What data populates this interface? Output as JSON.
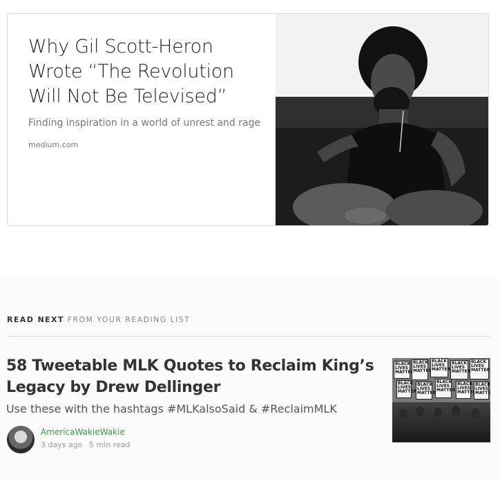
{
  "card": {
    "title_lines": [
      "Why Gil Scott-Heron",
      "Wrote “The Revolution",
      "Will Not Be Televised”"
    ],
    "subtitle": "Finding inspiration in a world of unrest and rage",
    "domain": "medium.com"
  },
  "read_next": {
    "label_strong": "READ NEXT",
    "label_muted": "FROM YOUR READING LIST",
    "post": {
      "title": "58 Tweetable MLK Quotes to Reclaim King’s Legacy by Drew Dellinger",
      "subtitle": "Use these with the hashtags #MLKalsoSaid & #ReclaimMLK",
      "author": "AmericaWakieWakie",
      "date": "3 days ago",
      "read_time": "5 min read"
    }
  },
  "colors": {
    "author": "#3a9a46",
    "muted": "#888888",
    "section_bg": "#fafafa"
  }
}
